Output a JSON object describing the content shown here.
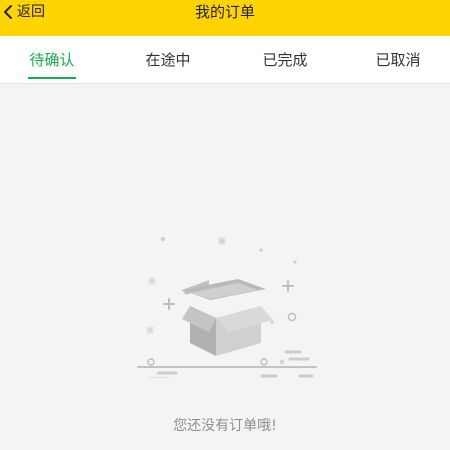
{
  "header": {
    "back_label": "返回",
    "title": "我的订单",
    "background_color": "#ffd400"
  },
  "tabs": [
    {
      "label": "待确认",
      "active": true
    },
    {
      "label": "在途中",
      "active": false
    },
    {
      "label": "已完成",
      "active": false
    },
    {
      "label": "已取消",
      "active": false
    }
  ],
  "tab_active_color": "#1aad4b",
  "empty_state": {
    "message": "您还没有订单哦!",
    "icon": "empty-box-icon"
  }
}
